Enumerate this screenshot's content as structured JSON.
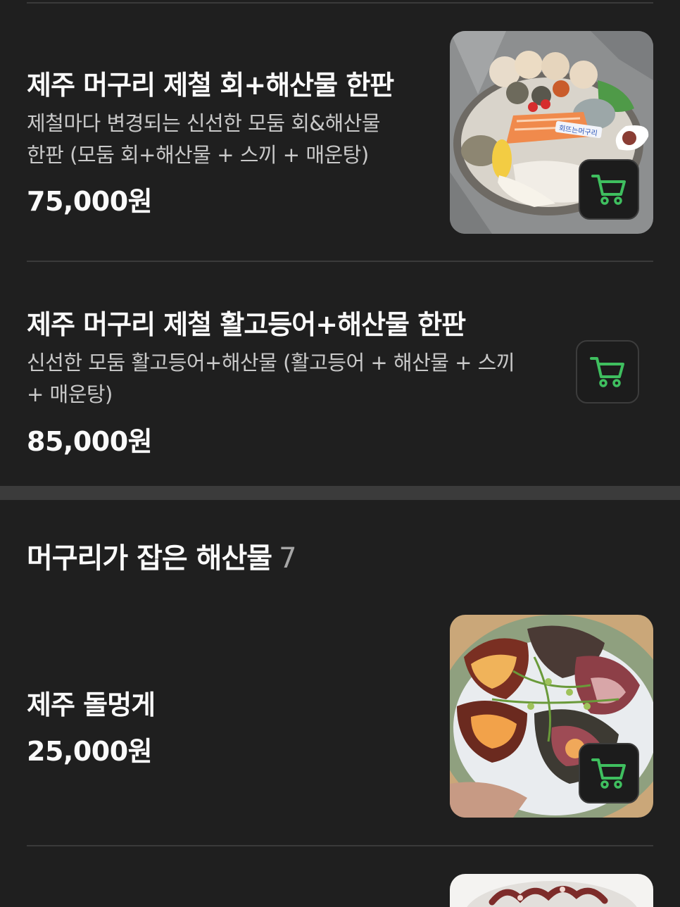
{
  "items": [
    {
      "title": "제주 머구리 제철 회+해산물 한판",
      "desc_line1": "제철마다 변경되는 신선한 모둠 회&해산물",
      "desc_line2": "한판 (모둠 회+해산물 + 스끼 + 매운탕)",
      "price": "75,000원",
      "image_label": "회뜨는머구리"
    },
    {
      "title": "제주 머구리 제철 활고등어+해산물 한판",
      "desc_line1": "신선한 모둠 활고등어+해산물 (활고등어 + 해산물 + 스끼",
      "desc_line2": "+ 매운탕)",
      "price": "85,000원"
    },
    {
      "title": "제주 돌멍게",
      "price": "25,000원"
    }
  ],
  "section": {
    "title": "머구리가 잡은 해산물",
    "count": "7"
  },
  "icons": {
    "cart": "shopping-cart-icon"
  },
  "colors": {
    "background": "#1f1f1f",
    "accent": "#3fbf5f"
  }
}
